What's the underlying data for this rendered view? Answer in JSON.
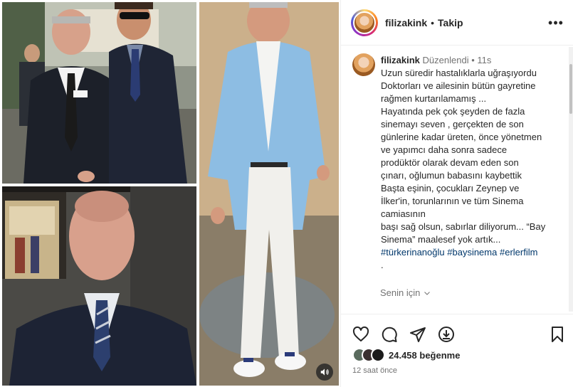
{
  "post": {
    "username": "filizakink",
    "follow_label": "Takip",
    "separator": "•",
    "more_label": "•••"
  },
  "caption": {
    "username": "filizakink",
    "edited_label": "Düzenlendi",
    "separator": "•",
    "time": "11s",
    "lines": [
      "Uzun süredir hastalıklarla uğraşıyordu",
      "Doktorları ve ailesinin bütün gayretine",
      "rağmen kurtarılamamış ...",
      "Hayatında pek çok şeyden de fazla",
      "sinemayı seven , gerçekten de son",
      "günlerine kadar üreten, önce yönetmen",
      "ve yapımcı daha sonra sadece",
      "prodüktör olarak devam eden son",
      "çınarı, oğlumun babasını kaybettik",
      "Başta eşinin, çocukları Zeynep ve",
      "İlker'in, torunlarının ve tüm Sinema",
      "camiasının",
      "başı sağ olsun, sabırlar diliyorum... “Bay",
      "Sinema” maalesef yok artık..."
    ],
    "hashtags": [
      "#türkerinanoğlu",
      "#baysinema",
      "#erlerfilm"
    ],
    "trailing": ".",
    "translate_label": "Senin için"
  },
  "actions": {
    "icons": [
      "heart-icon",
      "comment-icon",
      "share-icon",
      "download-icon",
      "bookmark-icon"
    ],
    "likes_text": "24.458 beğenme",
    "time_ago": "12 saat önce"
  },
  "colors": {
    "link": "#00376b",
    "muted": "#737373",
    "text": "#262626",
    "border": "#efefef"
  }
}
